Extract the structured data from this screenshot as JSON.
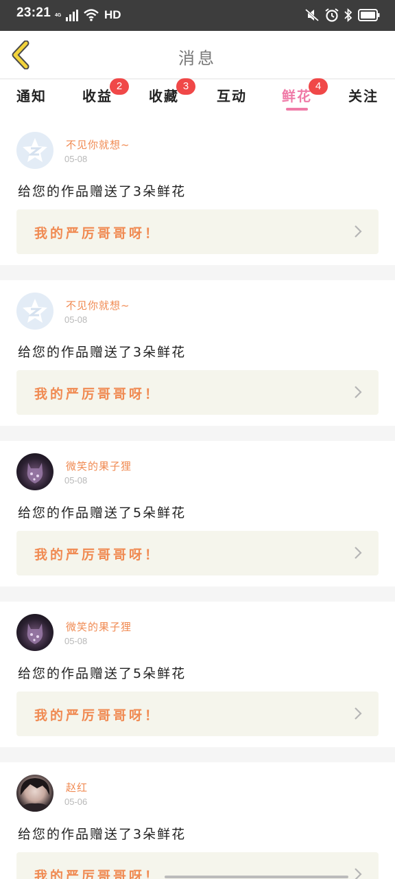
{
  "status_bar": {
    "time": "23:21",
    "network": "4G",
    "hd": "HD",
    "icons": [
      "signal-icon",
      "wifi-icon",
      "mute-icon",
      "alarm-icon",
      "bluetooth-icon",
      "battery-icon"
    ]
  },
  "header": {
    "back_icon": "chevron-left-icon",
    "title": "消息"
  },
  "tabs": [
    {
      "label": "通知",
      "badge": null
    },
    {
      "label": "收益",
      "badge": "2"
    },
    {
      "label": "收藏",
      "badge": "3"
    },
    {
      "label": "互动",
      "badge": null
    },
    {
      "label": "鲜花",
      "badge": "4",
      "active": true
    },
    {
      "label": "关注",
      "badge": null
    }
  ],
  "messages": [
    {
      "avatar": "default-avatar",
      "name": "不见你就想~",
      "date": "05-08",
      "text": "给您的作品赠送了3朵鲜花",
      "quote": "我的严厉哥哥呀！"
    },
    {
      "avatar": "default-avatar",
      "name": "不见你就想~",
      "date": "05-08",
      "text": "给您的作品赠送了3朵鲜花",
      "quote": "我的严厉哥哥呀！"
    },
    {
      "avatar": "fox-avatar",
      "name": "微笑的果子狸",
      "date": "05-08",
      "text": "给您的作品赠送了5朵鲜花",
      "quote": "我的严厉哥哥呀！"
    },
    {
      "avatar": "fox-avatar",
      "name": "微笑的果子狸",
      "date": "05-08",
      "text": "给您的作品赠送了5朵鲜花",
      "quote": "我的严厉哥哥呀！"
    },
    {
      "avatar": "boy-avatar",
      "name": "赵红",
      "date": "05-06",
      "text": "给您的作品赠送了3朵鲜花",
      "quote": "我的严厉哥哥呀！"
    }
  ],
  "colors": {
    "accent_pink": "#ef7aa7",
    "name_orange": "#f08a52",
    "badge_red": "#f04848",
    "back_yellow": "#f2d33b"
  }
}
